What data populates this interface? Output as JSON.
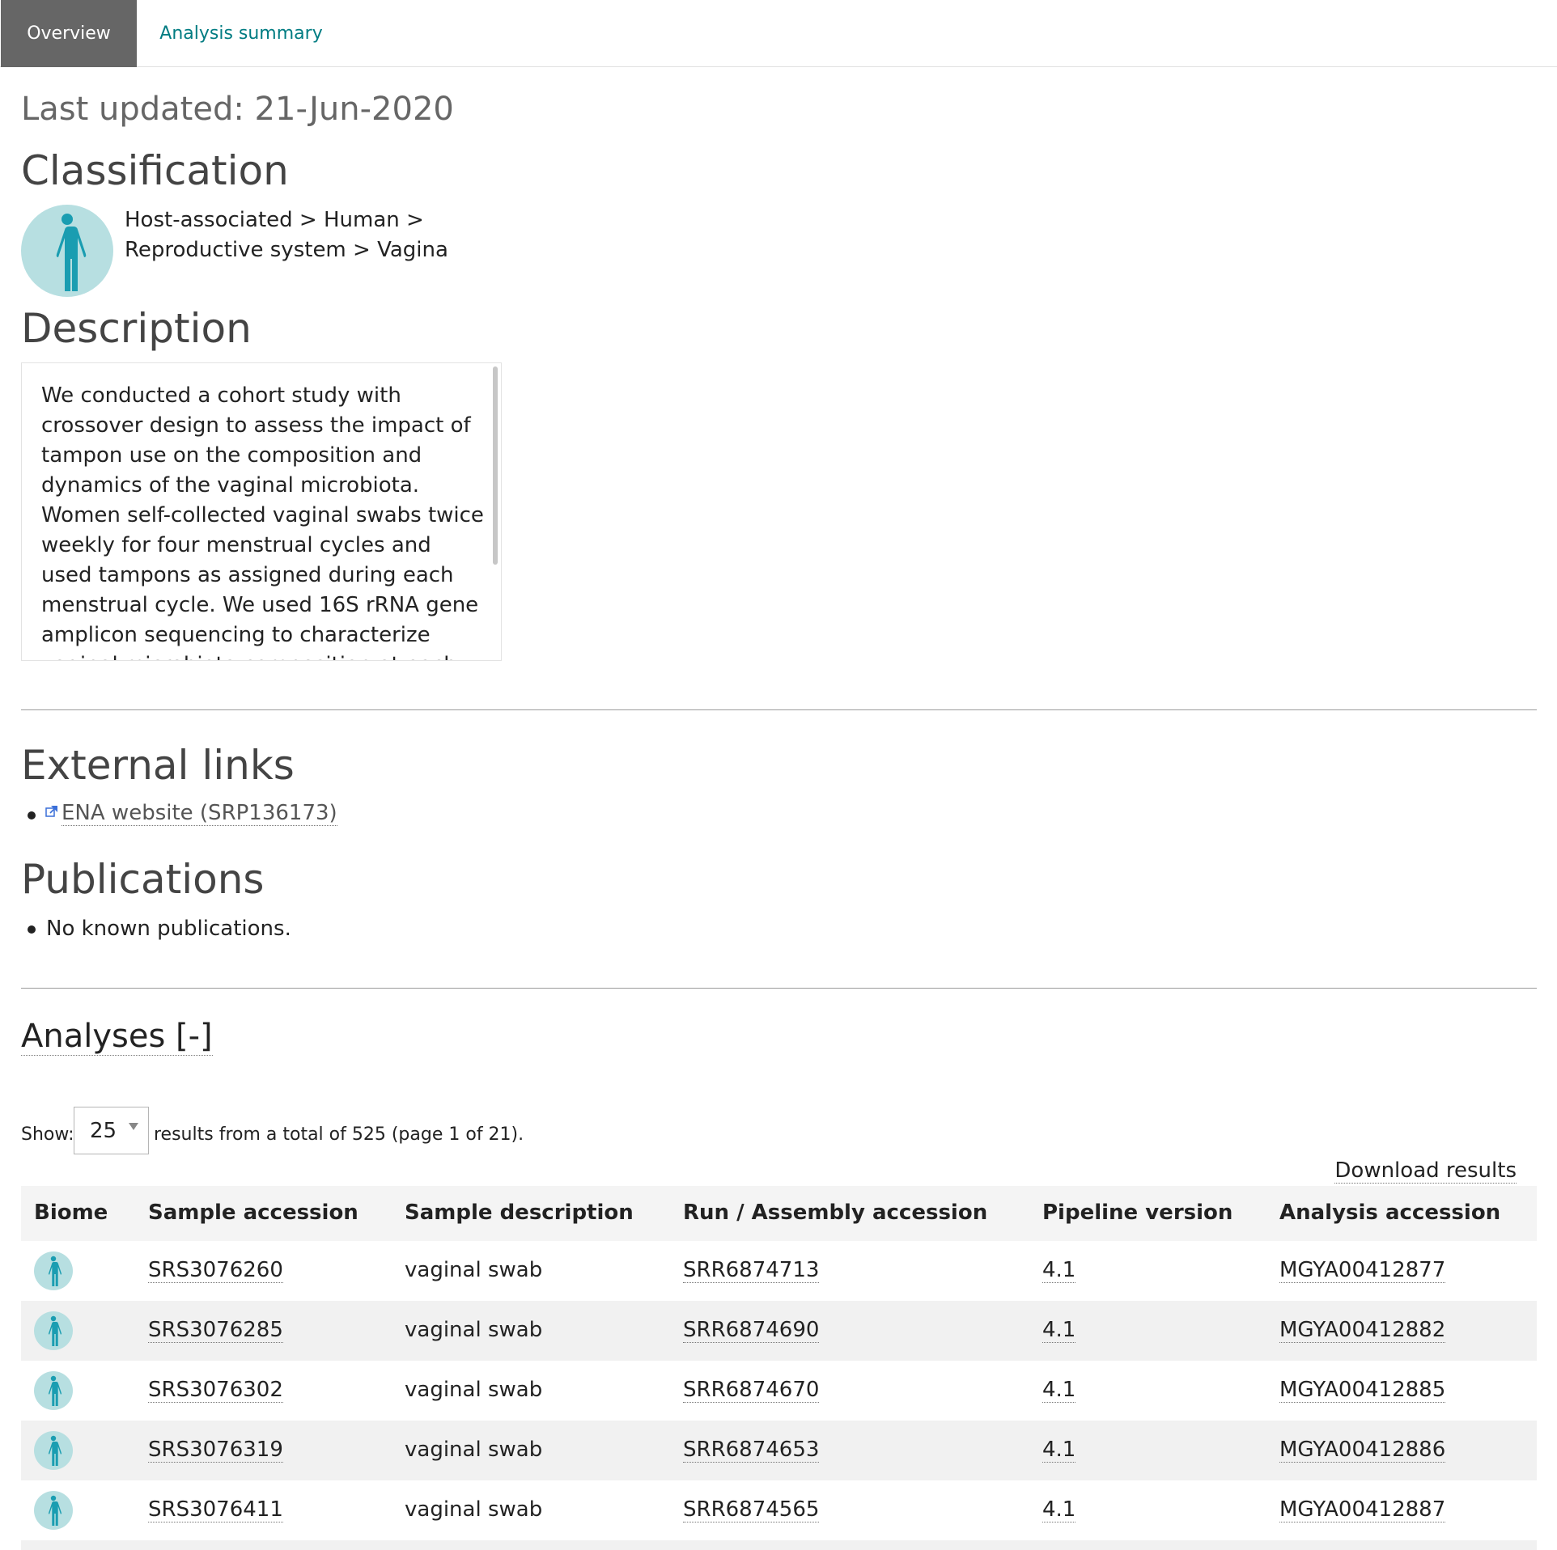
{
  "tabs": [
    {
      "label": "Overview",
      "active": true
    },
    {
      "label": "Analysis summary",
      "active": false
    }
  ],
  "last_updated": "Last updated: 21-Jun-2020",
  "classification": {
    "heading": "Classification",
    "line1": "Host-associated > Human >",
    "line2": "Reproductive system > Vagina",
    "icon": "human-body-icon"
  },
  "description": {
    "heading": "Description",
    "text": "We conducted a cohort study with crossover design to assess the impact of tampon use on the composition and dynamics of the vaginal microbiota. Women self-collected vaginal swabs twice weekly for four menstrual cycles and used tampons as assigned during each menstrual cycle. We used 16S rRNA gene amplicon sequencing to characterize vaginal microbiota composition at each time point and observed no significant trend of the vaginal"
  },
  "external_links": {
    "heading": "External links",
    "items": [
      {
        "label": "ENA website (SRP136173)",
        "icon": "external-link-icon"
      }
    ]
  },
  "publications": {
    "heading": "Publications",
    "items": [
      "No known publications."
    ]
  },
  "analyses": {
    "heading": "Analyses [-]",
    "show_label": "Show:",
    "page_size": "25",
    "results_text": "results from a total of 525 (page 1 of 21).",
    "download_label": "Download results",
    "columns": [
      "Biome",
      "Sample accession",
      "Sample description",
      "Run / Assembly accession",
      "Pipeline version",
      "Analysis accession"
    ],
    "rows": [
      {
        "sample": "SRS3076260",
        "description": "vaginal swab",
        "run": "SRR6874713",
        "pipeline": "4.1",
        "analysis": "MGYA00412877"
      },
      {
        "sample": "SRS3076285",
        "description": "vaginal swab",
        "run": "SRR6874690",
        "pipeline": "4.1",
        "analysis": "MGYA00412882"
      },
      {
        "sample": "SRS3076302",
        "description": "vaginal swab",
        "run": "SRR6874670",
        "pipeline": "4.1",
        "analysis": "MGYA00412885"
      },
      {
        "sample": "SRS3076319",
        "description": "vaginal swab",
        "run": "SRR6874653",
        "pipeline": "4.1",
        "analysis": "MGYA00412886"
      },
      {
        "sample": "SRS3076411",
        "description": "vaginal swab",
        "run": "SRR6874565",
        "pipeline": "4.1",
        "analysis": "MGYA00412887"
      }
    ]
  },
  "colors": {
    "tab_active_bg": "#666666",
    "link_teal": "#007c82",
    "biome_circle": "#b7dfe1",
    "biome_figure": "#1a9db1"
  }
}
